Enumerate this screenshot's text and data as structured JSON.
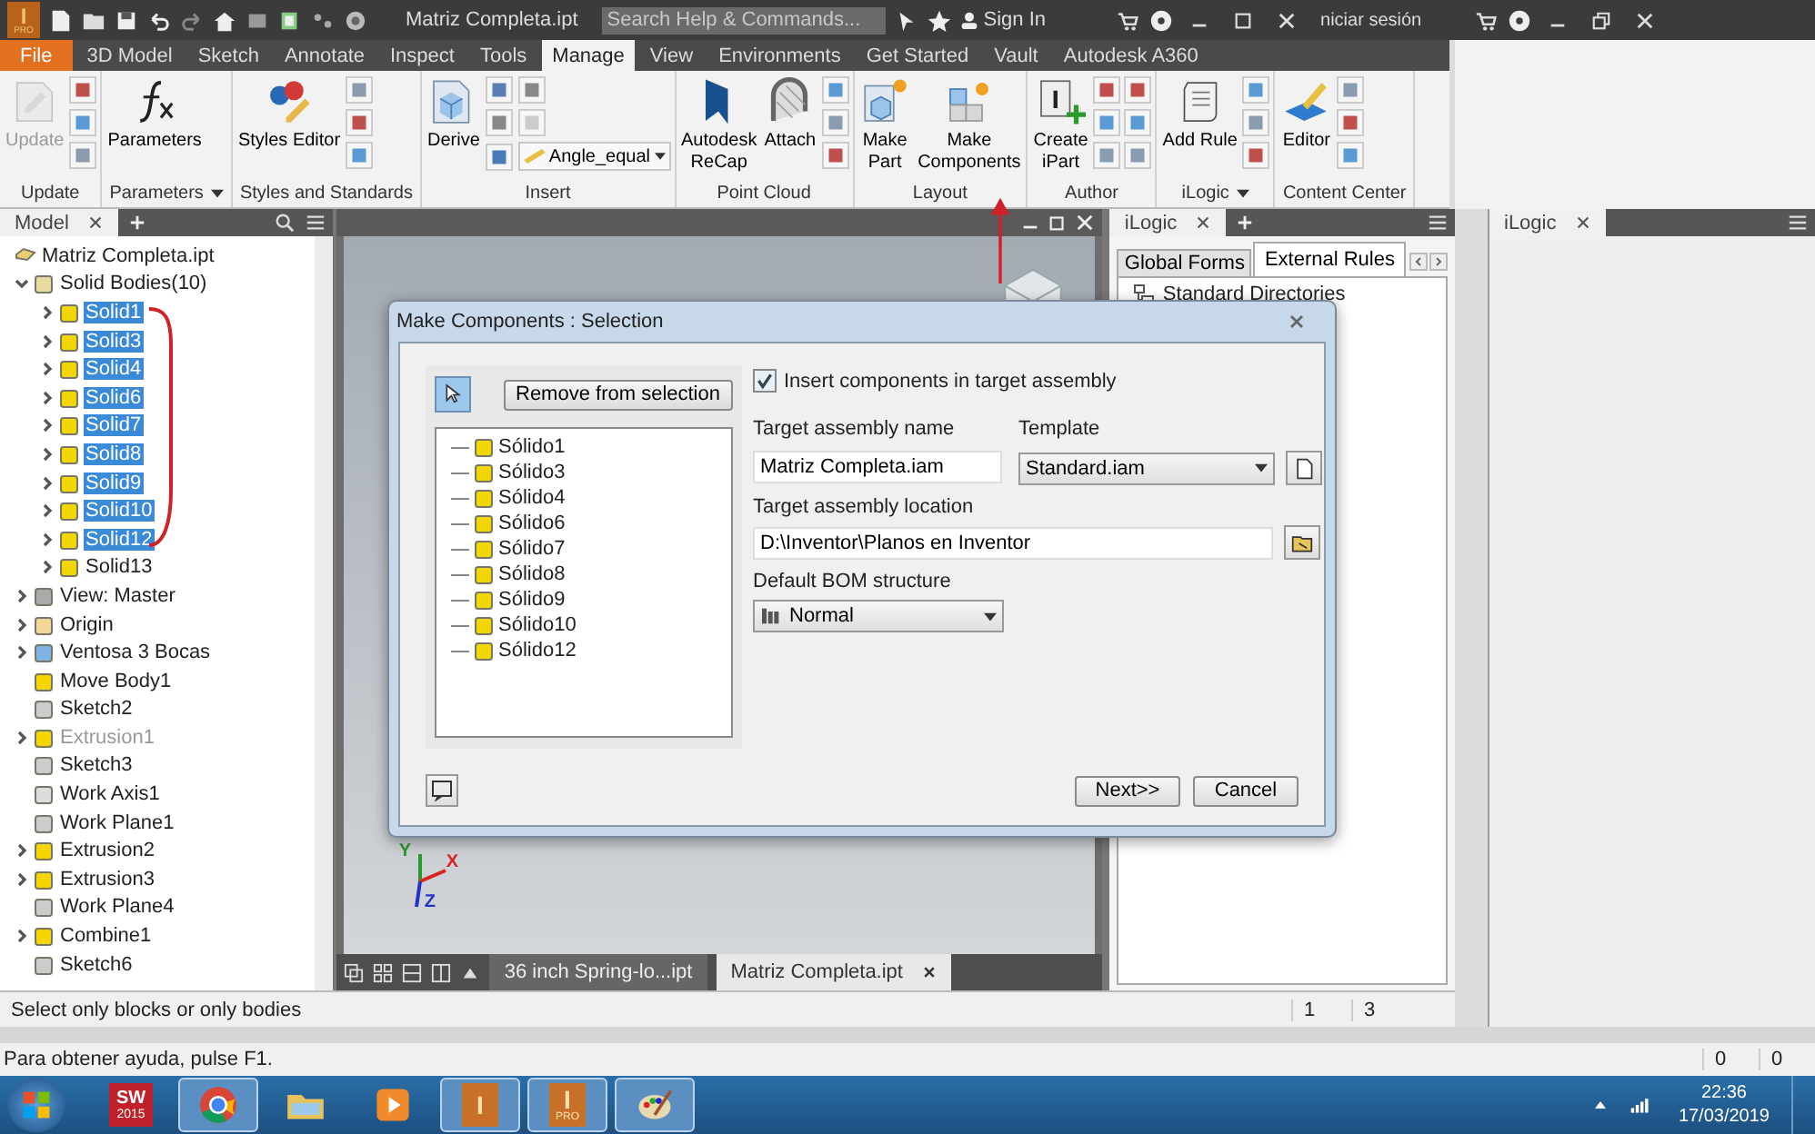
{
  "title_bar": {
    "logo": {
      "letters": "I",
      "sub": "PRO"
    },
    "title": "Matriz Completa.ipt",
    "search": {
      "placeholder": "Search Help & Commands..."
    },
    "sign_in": "Sign In",
    "other_window_sign_in": "niciar sesión"
  },
  "ribbon": {
    "tabs": [
      {
        "label": "File",
        "kind": "file",
        "selected": false
      },
      {
        "label": "3D Model",
        "kind": "tab",
        "selected": false
      },
      {
        "label": "Sketch",
        "kind": "tab",
        "selected": false
      },
      {
        "label": "Annotate",
        "kind": "tab",
        "selected": false
      },
      {
        "label": "Inspect",
        "kind": "tab",
        "selected": false
      },
      {
        "label": "Tools",
        "kind": "tab",
        "selected": false
      },
      {
        "label": "Manage",
        "kind": "tab",
        "selected": true
      },
      {
        "label": "View",
        "kind": "tab",
        "selected": false
      },
      {
        "label": "Environments",
        "kind": "tab",
        "selected": false
      },
      {
        "label": "Get Started",
        "kind": "tab",
        "selected": false
      },
      {
        "label": "Vault",
        "kind": "tab",
        "selected": false
      },
      {
        "label": "Autodesk A360",
        "kind": "tab",
        "selected": false
      }
    ],
    "groups": [
      {
        "label": "Update",
        "menu": false,
        "items": [
          {
            "kind": "large",
            "lines": [
              "Update"
            ],
            "disabled": true
          },
          {
            "kind": "tools"
          }
        ]
      },
      {
        "label": "Parameters",
        "menu": true,
        "items": [
          {
            "kind": "large",
            "lines": [
              "Parameters"
            ],
            "disabled": false
          }
        ]
      },
      {
        "label": "Styles and Standards",
        "menu": false,
        "items": [
          {
            "kind": "large",
            "lines": [
              "Styles Editor"
            ],
            "disabled": false
          },
          {
            "kind": "tools"
          }
        ]
      },
      {
        "label": "Insert",
        "menu": false,
        "items": [
          {
            "kind": "large",
            "lines": [
              "Derive"
            ],
            "disabled": false
          },
          {
            "kind": "combo",
            "value": "Angle_equal"
          }
        ]
      },
      {
        "label": "Point Cloud",
        "menu": false,
        "items": [
          {
            "kind": "large",
            "lines": [
              "Autodesk",
              "ReCap"
            ],
            "disabled": false
          },
          {
            "kind": "large",
            "lines": [
              "Attach"
            ],
            "disabled": false
          },
          {
            "kind": "tools"
          }
        ]
      },
      {
        "label": "Layout",
        "menu": false,
        "items": [
          {
            "kind": "large",
            "lines": [
              "Make",
              "Part"
            ],
            "disabled": false
          },
          {
            "kind": "large",
            "lines": [
              "Make",
              "Components"
            ],
            "disabled": false
          }
        ]
      },
      {
        "label": "Author",
        "menu": false,
        "items": [
          {
            "kind": "large",
            "lines": [
              "Create",
              "iPart"
            ],
            "disabled": false
          },
          {
            "kind": "tools"
          },
          {
            "kind": "tools"
          }
        ]
      },
      {
        "label": "iLogic",
        "menu": true,
        "items": [
          {
            "kind": "large",
            "lines": [
              "Add Rule"
            ],
            "disabled": false
          },
          {
            "kind": "tools"
          }
        ]
      },
      {
        "label": "Content Center",
        "menu": false,
        "items": [
          {
            "kind": "large",
            "lines": [
              "Editor"
            ],
            "disabled": false
          },
          {
            "kind": "tools"
          }
        ]
      }
    ]
  },
  "model_browser": {
    "tab": "Model",
    "root": {
      "label": "Matriz Completa.ipt",
      "children": [
        {
          "label": "Solid Bodies(10)",
          "kind": "bodies",
          "expandable": true,
          "expanded": true,
          "selected": false,
          "disabled": false,
          "children": [
            {
              "label": "Solid1",
              "kind": "solid",
              "expandable": true,
              "expanded": false,
              "selected": true,
              "disabled": false
            },
            {
              "label": "Solid3",
              "kind": "solid",
              "expandable": true,
              "expanded": false,
              "selected": true,
              "disabled": false
            },
            {
              "label": "Solid4",
              "kind": "solid",
              "expandable": true,
              "expanded": false,
              "selected": true,
              "disabled": false
            },
            {
              "label": "Solid6",
              "kind": "solid",
              "expandable": true,
              "expanded": false,
              "selected": true,
              "disabled": false
            },
            {
              "label": "Solid7",
              "kind": "solid",
              "expandable": true,
              "expanded": false,
              "selected": true,
              "disabled": false
            },
            {
              "label": "Solid8",
              "kind": "solid",
              "expandable": true,
              "expanded": false,
              "selected": true,
              "disabled": false
            },
            {
              "label": "Solid9",
              "kind": "solid",
              "expandable": true,
              "expanded": false,
              "selected": true,
              "disabled": false
            },
            {
              "label": "Solid10",
              "kind": "solid",
              "expandable": true,
              "expanded": false,
              "selected": true,
              "disabled": false
            },
            {
              "label": "Solid12",
              "kind": "solid",
              "expandable": true,
              "expanded": false,
              "selected": true,
              "disabled": false
            },
            {
              "label": "Solid13",
              "kind": "solid",
              "expandable": true,
              "expanded": false,
              "selected": false,
              "disabled": false
            }
          ]
        },
        {
          "label": "View: Master",
          "kind": "view",
          "expandable": true,
          "expanded": false,
          "selected": false,
          "disabled": false
        },
        {
          "label": "Origin",
          "kind": "folder",
          "expandable": true,
          "expanded": false,
          "selected": false,
          "disabled": false
        },
        {
          "label": "Ventosa 3 Bocas",
          "kind": "part",
          "expandable": true,
          "expanded": false,
          "selected": false,
          "disabled": false
        },
        {
          "label": "Move Body1",
          "kind": "move",
          "expandable": false,
          "expanded": false,
          "selected": false,
          "disabled": false
        },
        {
          "label": "Sketch2",
          "kind": "sketch",
          "expandable": false,
          "expanded": false,
          "selected": false,
          "disabled": false
        },
        {
          "label": "Extrusion1",
          "kind": "extrusion",
          "expandable": true,
          "expanded": false,
          "selected": false,
          "disabled": true
        },
        {
          "label": "Sketch3",
          "kind": "sketch",
          "expandable": false,
          "expanded": false,
          "selected": false,
          "disabled": false
        },
        {
          "label": "Work Axis1",
          "kind": "axis",
          "expandable": false,
          "expanded": false,
          "selected": false,
          "disabled": false
        },
        {
          "label": "Work Plane1",
          "kind": "plane",
          "expandable": false,
          "expanded": false,
          "selected": false,
          "disabled": false
        },
        {
          "label": "Extrusion2",
          "kind": "extrusion",
          "expandable": true,
          "expanded": false,
          "selected": false,
          "disabled": false
        },
        {
          "label": "Extrusion3",
          "kind": "extrusion",
          "expandable": true,
          "expanded": false,
          "selected": false,
          "disabled": false
        },
        {
          "label": "Work Plane4",
          "kind": "plane",
          "expandable": false,
          "expanded": false,
          "selected": false,
          "disabled": false
        },
        {
          "label": "Combine1",
          "kind": "solid",
          "expandable": true,
          "expanded": false,
          "selected": false,
          "disabled": false
        },
        {
          "label": "Sketch6",
          "kind": "sketch",
          "expandable": false,
          "expanded": false,
          "selected": false,
          "disabled": false
        }
      ]
    }
  },
  "status": {
    "text": "Select only blocks or only bodies",
    "counts": [
      "1",
      "3"
    ]
  },
  "viewport": {
    "axis_labels": {
      "x": "X",
      "y": "Y",
      "z": "Z"
    },
    "doc_tabs": [
      {
        "label": "36 inch Spring-lo...ipt",
        "selected": false,
        "closable": false
      },
      {
        "label": "Matriz Completa.ipt",
        "selected": true,
        "closable": true
      }
    ]
  },
  "ilogic_panel": {
    "tab": "iLogic",
    "subtabs": [
      {
        "label": "Global Forms",
        "selected": false
      },
      {
        "label": "External Rules",
        "selected": true
      }
    ],
    "items": [
      "Standard Directories"
    ]
  },
  "side_panel": {
    "tab": "iLogic"
  },
  "dialog": {
    "title": "Make Components : Selection",
    "select_tool": {
      "selected": true
    },
    "remove_button": "Remove from selection",
    "bodies": [
      "Sólido1",
      "Sólido3",
      "Sólido4",
      "Sólido6",
      "Sólido7",
      "Sólido8",
      "Sólido9",
      "Sólido10",
      "Sólido12"
    ],
    "insert_checkbox": {
      "label": "Insert components in target assembly",
      "checked": true
    },
    "name_label": "Target assembly name",
    "name_value": "Matriz Completa.iam",
    "template_label": "Template",
    "template_value": "Standard.iam",
    "location_label": "Target assembly location",
    "location_value": "D:\\Inventor\\Planos en Inventor",
    "bom_label": "Default BOM structure",
    "bom_value": "Normal",
    "buttons": [
      "Next>>",
      "Cancel"
    ]
  },
  "help_bar": {
    "text": "Para obtener ayuda, pulse F1.",
    "counts": [
      "0",
      "0"
    ]
  },
  "taskbar": {
    "apps": [
      {
        "kind": "start",
        "running": false
      },
      {
        "kind": "badge",
        "letters": "SW",
        "sub": "2015",
        "running": false
      },
      {
        "kind": "browser",
        "running": true
      },
      {
        "kind": "folder",
        "running": false
      },
      {
        "kind": "media",
        "running": false
      },
      {
        "kind": "letter",
        "letters": "I",
        "running": true
      },
      {
        "kind": "letter",
        "letters": "I",
        "sub": "PRO",
        "running": true
      },
      {
        "kind": "paint",
        "running": true
      }
    ],
    "time": "22:36",
    "date": "17/03/2019"
  }
}
